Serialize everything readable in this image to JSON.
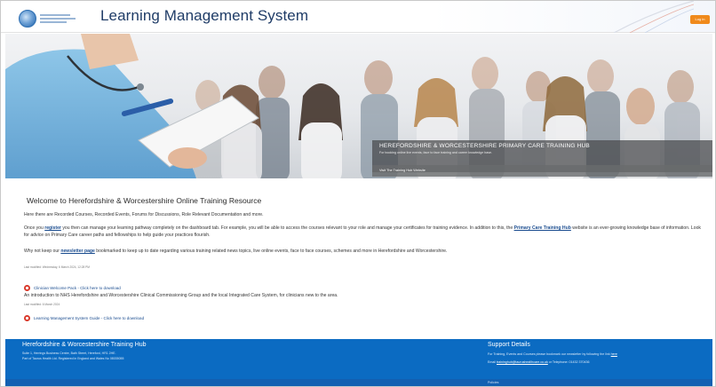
{
  "header": {
    "title": "Learning Management System",
    "login_label": "Log in"
  },
  "hero": {
    "overlay_title": "HEREFORDSHIRE & WORCESTERSHIRE PRIMARY CARE TRAINING HUB",
    "overlay_sub": "For booking online live events, face to face training and career knowledge base.",
    "overlay_link": "Visit The Training Hub Website"
  },
  "content": {
    "welcome_title": "Welcome to Herefordshire & Worcestershire Online Training Resource",
    "p1": "Here there are Recorded Courses, Recorded Events, Forums for Discussions, Role Relevant Documentation and more.",
    "p2_a": "Once you ",
    "p2_link1": "register",
    "p2_b": " you then can manage your learning pathway completely on the dashboard tab. For example, you will be able to access the courses relevant to your role and manage your certificates for training evidence. In addition to this, the ",
    "p2_link2": "Primary Care Training Hub",
    "p2_c": " website is an ever-growing knowledge base of information. Look for advice on Primary Care career paths and fellowships to help guide your practices flourish.",
    "p3_a": "Why not keep our ",
    "p3_link": "newsletter page",
    "p3_b": " bookmarked to keep up to date regarding various training related news topics, live online events, face to face courses, schemes and more in Herefordshire and Worcestershire.",
    "tiny1": "Last modified: Wednesday, 6 March 2024, 12:28 PM",
    "doc1_link": "Clinician Welcome Pack - Click here to download",
    "doc1_desc": "An introduction to NHS Herefordshire and Worcestershire Clinical Commissioning Group and the local Integrated Care System, for clinicians new to the area.",
    "tiny2": "Last modified: 6 March 2024",
    "doc2_link": "Learning Management System Guide - Click here to download"
  },
  "footer": {
    "left_title": "Herefordshire & Worcestershire Training Hub",
    "left_line1": "Suite 1, Herrings Business Centre, Bath Street, Hereford, HR1 2HE.",
    "left_line2": "Part of Taurus Health Ltd. Registered in England and Wales No 08035055",
    "right_title": "Support Details",
    "right_line1_a": "For Training, Events and Courses please bookmark our newsletter by following the link ",
    "right_line1_link": "here",
    "right_line2_a": "Email ",
    "right_line2_link": "traininghub@taurushealthcare.co.uk",
    "right_line2_b": " or Telephone: 01432 370436",
    "bottom_text": "Policies"
  },
  "colors": {
    "brand_blue": "#0b6bc2",
    "accent_orange": "#f08a1c",
    "link_blue": "#1a4c8f"
  }
}
